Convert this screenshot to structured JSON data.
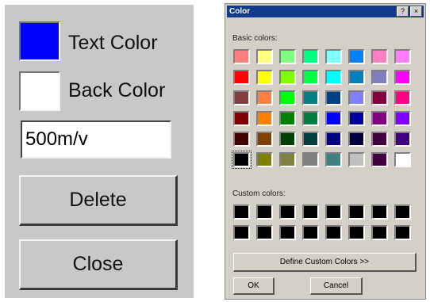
{
  "left_panel": {
    "text_color_label": "Text Color",
    "back_color_label": "Back Color",
    "text_color": "#0000ff",
    "back_color": "#ffffff",
    "value_input": "500m/v",
    "delete_label": "Delete",
    "close_label": "Close"
  },
  "color_dialog": {
    "title": "Color",
    "help_icon": "?",
    "close_icon": "×",
    "basic_colors_label": "Basic colors:",
    "custom_colors_label": "Custom colors:",
    "basic_colors": [
      "#ff8080",
      "#ffff80",
      "#80ff80",
      "#00ff80",
      "#80ffff",
      "#0080ff",
      "#ff80c0",
      "#ff80ff",
      "#ff0000",
      "#ffff00",
      "#80ff00",
      "#00ff40",
      "#00ffff",
      "#0080c0",
      "#8080c0",
      "#ff00ff",
      "#804040",
      "#ff8040",
      "#00ff00",
      "#008080",
      "#004080",
      "#8080ff",
      "#800040",
      "#ff0080",
      "#800000",
      "#ff8000",
      "#008000",
      "#008040",
      "#0000ff",
      "#0000a0",
      "#800080",
      "#8000ff",
      "#400000",
      "#804000",
      "#004000",
      "#004040",
      "#000080",
      "#000040",
      "#400040",
      "#400080",
      "#000000",
      "#808000",
      "#808040",
      "#808080",
      "#408080",
      "#c0c0c0",
      "#400040",
      "#ffffff"
    ],
    "selected_index": 40,
    "custom_colors": [
      "#000000",
      "#000000",
      "#000000",
      "#000000",
      "#000000",
      "#000000",
      "#000000",
      "#000000",
      "#000000",
      "#000000",
      "#000000",
      "#000000",
      "#000000",
      "#000000",
      "#000000",
      "#000000"
    ],
    "define_custom_label": "Define Custom Colors >>",
    "ok_label": "OK",
    "cancel_label": "Cancel"
  }
}
